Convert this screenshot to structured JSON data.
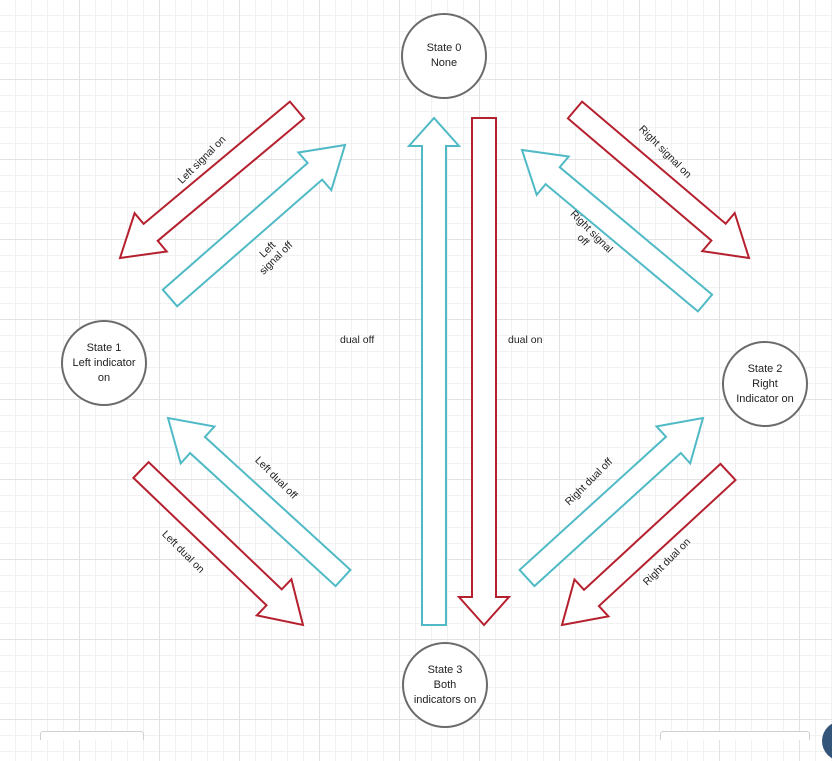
{
  "states": [
    {
      "id": "state-0",
      "lines": [
        "State 0",
        "None"
      ]
    },
    {
      "id": "state-1",
      "lines": [
        "State 1",
        "Left indicator",
        "on"
      ]
    },
    {
      "id": "state-2",
      "lines": [
        "State 2",
        "Right",
        "Indicator on"
      ]
    },
    {
      "id": "state-3",
      "lines": [
        "State 3",
        "Both",
        "indicators on"
      ]
    }
  ],
  "transitions": {
    "left_signal_on": "Left signal on",
    "left_signal_off": [
      "Left",
      "signal off"
    ],
    "right_signal_on": "Right signal on",
    "right_signal_off": [
      "Right signal",
      "off"
    ],
    "dual_off": "dual off",
    "dual_on": "dual on",
    "left_dual_off": "Left dual off",
    "left_dual_on": "Left dual on",
    "right_dual_off": "Right dual off",
    "right_dual_on": "Right dual on"
  },
  "colors": {
    "on_arrow": "#b5202e",
    "off_arrow": "#4fbac6",
    "state_border": "#6b6b6b",
    "grid": "#e2e2e2"
  }
}
